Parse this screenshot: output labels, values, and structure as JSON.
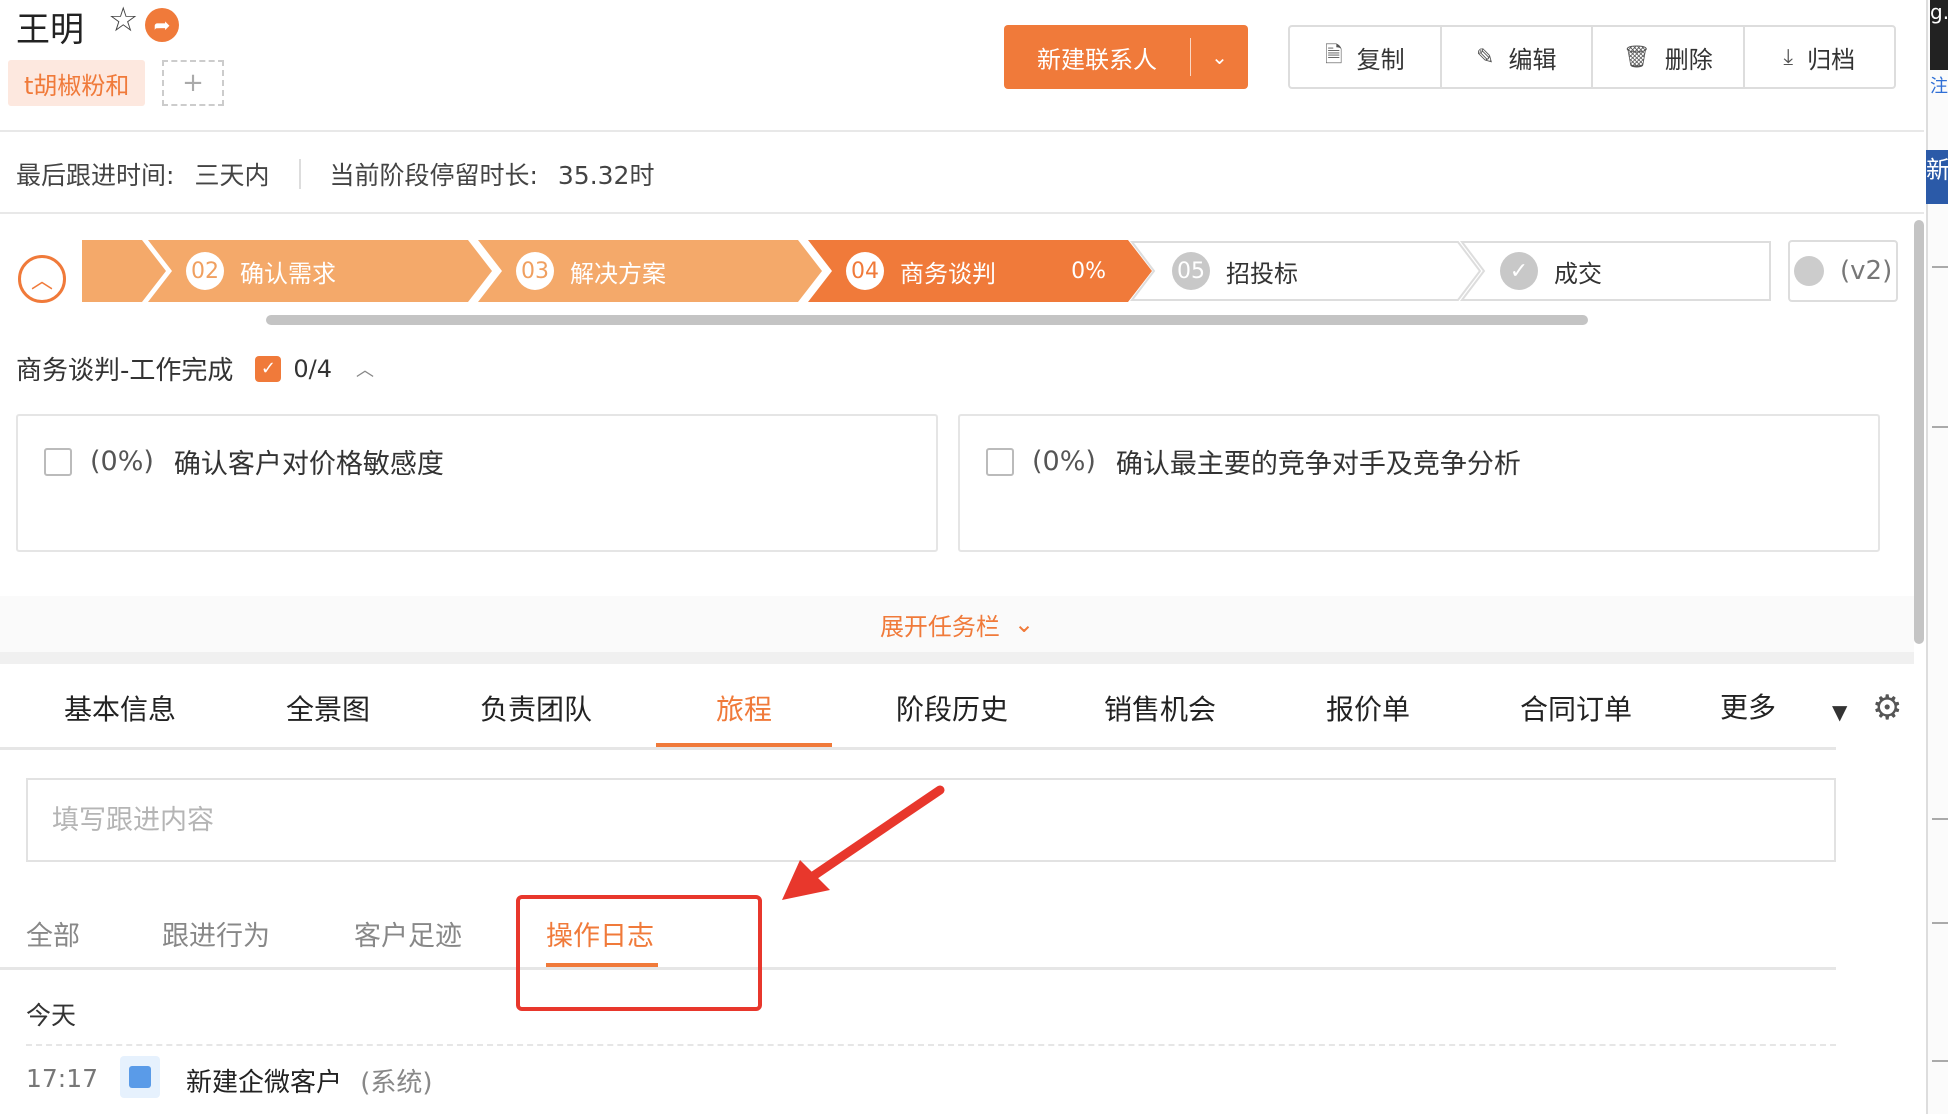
{
  "header": {
    "title": "王明",
    "tag": "t胡椒粉和",
    "add_tag": "+",
    "primary_button": "新建联系人",
    "actions": [
      "复制",
      "编辑",
      "删除",
      "归档"
    ]
  },
  "info": {
    "last_follow_label": "最后跟进时间:",
    "last_follow_value": "三天内",
    "stay_label": "当前阶段停留时长:",
    "stay_value": "35.32时"
  },
  "stages": [
    {
      "num": "02",
      "label": "确认需求",
      "state": "done"
    },
    {
      "num": "03",
      "label": "解决方案",
      "state": "done"
    },
    {
      "num": "04",
      "label": "商务谈判",
      "state": "current",
      "percent": "0%"
    },
    {
      "num": "05",
      "label": "招投标",
      "state": "todo"
    },
    {
      "num": "✓",
      "label": "成交",
      "state": "todo"
    }
  ],
  "version": "(v2)",
  "task": {
    "title": "商务谈判-工作完成",
    "count": "0/4",
    "items": [
      {
        "percent": "(0%)",
        "text": "确认客户对价格敏感度"
      },
      {
        "percent": "(0%)",
        "text": "确认最主要的竞争对手及竞争分析"
      }
    ],
    "expand_label": "展开任务栏"
  },
  "tabs": [
    "基本信息",
    "全景图",
    "负责团队",
    "旅程",
    "阶段历史",
    "销售机会",
    "报价单",
    "合同订单",
    "更多"
  ],
  "active_tab": "旅程",
  "follow_input_placeholder": "填写跟进内容",
  "subtabs": [
    "全部",
    "跟进行为",
    "客户足迹",
    "操作日志"
  ],
  "active_subtab": "操作日志",
  "log": {
    "day": "今天",
    "entries": [
      {
        "time": "17:17",
        "text": "新建企微客户",
        "source": "(系统)"
      }
    ]
  },
  "edge_fragments": {
    "top": "g.r",
    "link": "注册",
    "nav": "新"
  },
  "colors": {
    "accent": "#f07a3a",
    "accent_light": "#f4a96a",
    "highlight": "#e8372c"
  }
}
